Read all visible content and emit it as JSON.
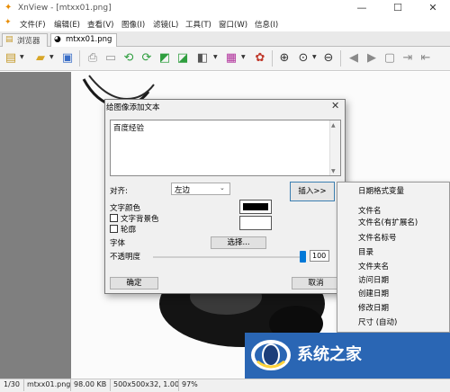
{
  "window": {
    "title": "XnView - [mtxx01.png]",
    "icon": "xnview-logo-icon",
    "controls": [
      "minimize-icon",
      "maximize-icon",
      "close-icon"
    ]
  },
  "menu": {
    "items": [
      "文件(F)",
      "编辑(E)",
      "查看(V)",
      "图像(I)",
      "滤镜(L)",
      "工具(T)",
      "窗口(W)",
      "信息(I)"
    ]
  },
  "tabs": [
    {
      "label": "浏览器",
      "icon": "folder-tree-icon",
      "active": false
    },
    {
      "label": "mtxx01.png",
      "icon": "image-file-icon",
      "active": true
    }
  ],
  "toolbar": {
    "icons": [
      "browser-icon",
      "open-folder-icon",
      "save-icon",
      "print-icon",
      "scan-icon",
      "rotate-left-icon",
      "rotate-right-icon",
      "fit-icon",
      "slideshow-icon",
      "adjust-icon",
      "color-icon",
      "filter-icon",
      "zoom-in-icon",
      "zoom-dropdown-icon",
      "zoom-out-icon",
      "back-icon",
      "forward-icon",
      "fullscreen-icon",
      "next-icon"
    ]
  },
  "dialog": {
    "title": "给图像添加文本",
    "text_value": "百度经验",
    "align_label": "对齐:",
    "align_value": "左边",
    "insert_label": "插入>>",
    "text_color_label": "文字颜色",
    "text_bg_label": "文字背景色",
    "text_bg_checked": false,
    "outline_label": "轮廓",
    "outline_checked": false,
    "font_label": "字体",
    "choose_label": "选择...",
    "opacity_label": "不透明度",
    "opacity_value": "100",
    "ok_label": "确定",
    "cancel_label": "取消"
  },
  "insert_menu": {
    "items": [
      "日期格式变量",
      "文件名",
      "文件名(有扩展名)",
      "文件名标号",
      "目录",
      "文件夹名",
      "访问日期",
      "创建日期",
      "修改日期",
      "尺寸 (自动)"
    ]
  },
  "status": {
    "index": "1/30",
    "filename": "mtxx01.png",
    "filesize": "98.00 KB",
    "dimensions": "500x500x32, 1.00",
    "zoom": "97%"
  },
  "watermark": {
    "text": "系统之家"
  },
  "colors": {
    "accent": "#0078d7",
    "canvas_gray": "#7f7f7f",
    "watermark_blue": "#2a66b4"
  }
}
